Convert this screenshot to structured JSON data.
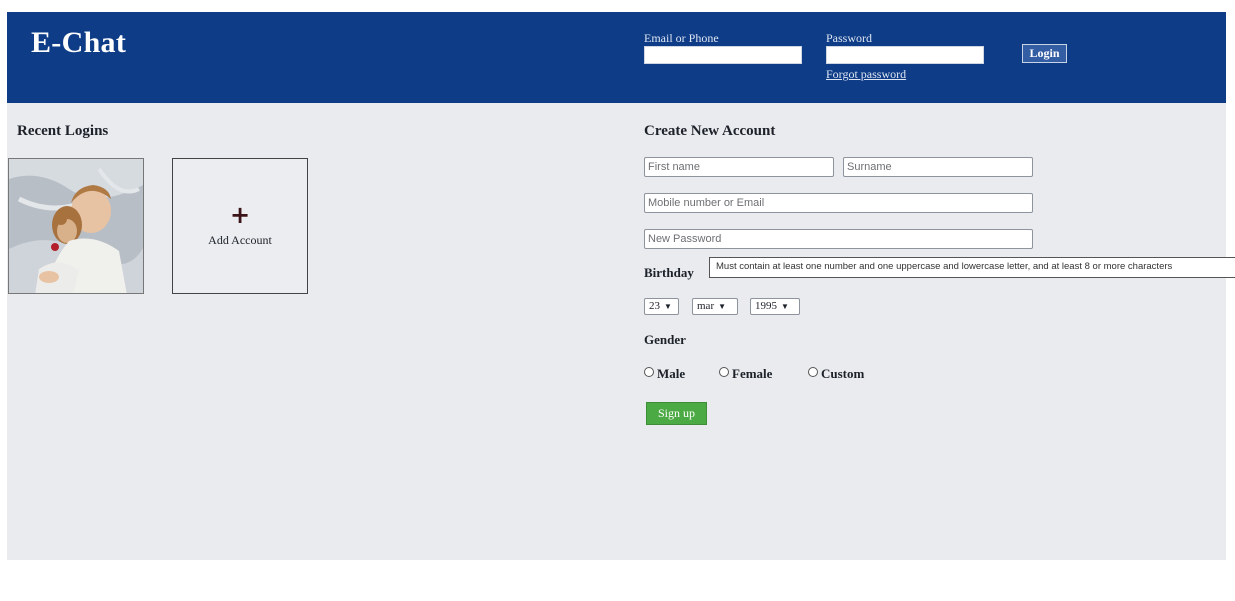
{
  "brand": {
    "title": "E-Chat"
  },
  "login": {
    "email_label": "Email or Phone",
    "email_value": "",
    "password_label": "Password",
    "password_value": "",
    "login_button": "Login",
    "forgot_link": "Forgot password"
  },
  "recent_logins": {
    "title": "Recent Logins",
    "add_account_icon": "+",
    "add_account_label": "Add Account"
  },
  "signup": {
    "title": "Create New Account",
    "first_name_placeholder": "First name",
    "surname_placeholder": "Surname",
    "contact_placeholder": "Mobile number or Email",
    "password_placeholder": "New Password",
    "birthday_label": "Birthday",
    "password_tooltip": "Must contain at least one number and one uppercase and lowercase letter, and at least 8 or more characters",
    "birthday_day": "23",
    "birthday_month": "mar",
    "birthday_year": "1995",
    "gender_label": "Gender",
    "gender_options": [
      "Male",
      "Female",
      "Custom"
    ],
    "signup_button": "Sign up"
  },
  "colors": {
    "header_bg": "#0e3c86",
    "page_bg": "#e9ebee",
    "signup_button": "#4caa44"
  }
}
